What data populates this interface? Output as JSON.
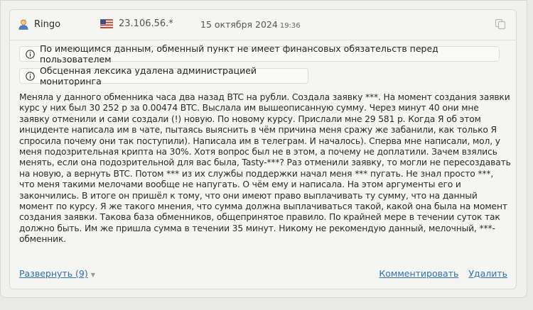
{
  "review": {
    "username": "Ringo",
    "ip": "23.106.56.*",
    "date": "15 октября 2024",
    "time": "19:36",
    "icons": {
      "user": "user-avatar-icon",
      "flag": "us-flag-icon",
      "copy": "copy-icon",
      "info": "info-icon"
    },
    "notices": [
      "По имеющимся данным, обменный пункт не имеет финансовых обязательств перед пользователем",
      "Обсценная лексика удалена администрацией мониторинга"
    ],
    "text": "Меняла у данного обменника часа два назад BTC на рубли. Создала заявку ***. На момент создания заявки курс у них был 30 252 р за 0.00474 BTC. Выслала им вышеописанную сумму. Через минут 40 они мне заявку отменили и сами создали (!) новую. По новому курсу. Прислали мне 29 581 р. Когда Я об этом инциденте написала им в чате, пытаясь выяснить в чём причина меня сражу же забанили, как только Я спросила почему они так поступили). Написала им в телеграм. И началось). Сперва мне написали, мол, у меня подозрительная крипта на 30%. Хотя вопрос был не в этом, а почему не доплатили. Зачем взялись менять, если она подозрительной для вас была, Tasty-***? Раз отменили заявку, то могли не пересоздавать на новую, а вернуть BTC. Потом *** из их службы поддержки начал меня *** пугать. Не знал просто ***, что меня такими мелочами вообще не напугать. О чём ему и написала. На этом аргументы его и закончились. В итоге он пришёл к тому, что они имеют право выплачивать ту сумму, что на данный момент по курсу. Я же такого мнения, что сумма должна выплачиваться такой, какой она была на момент создания заявки. Такова база обменников, общепринятое правило. По крайней мере в течении суток так должно быть. Им же пришла сумма в течении 35 минут. Никому не рекомендую данный, мелочный, ***-обменник.",
    "expand_label": "Развернуть (9)",
    "comment_label": "Комментировать",
    "delete_label": "Удалить"
  }
}
